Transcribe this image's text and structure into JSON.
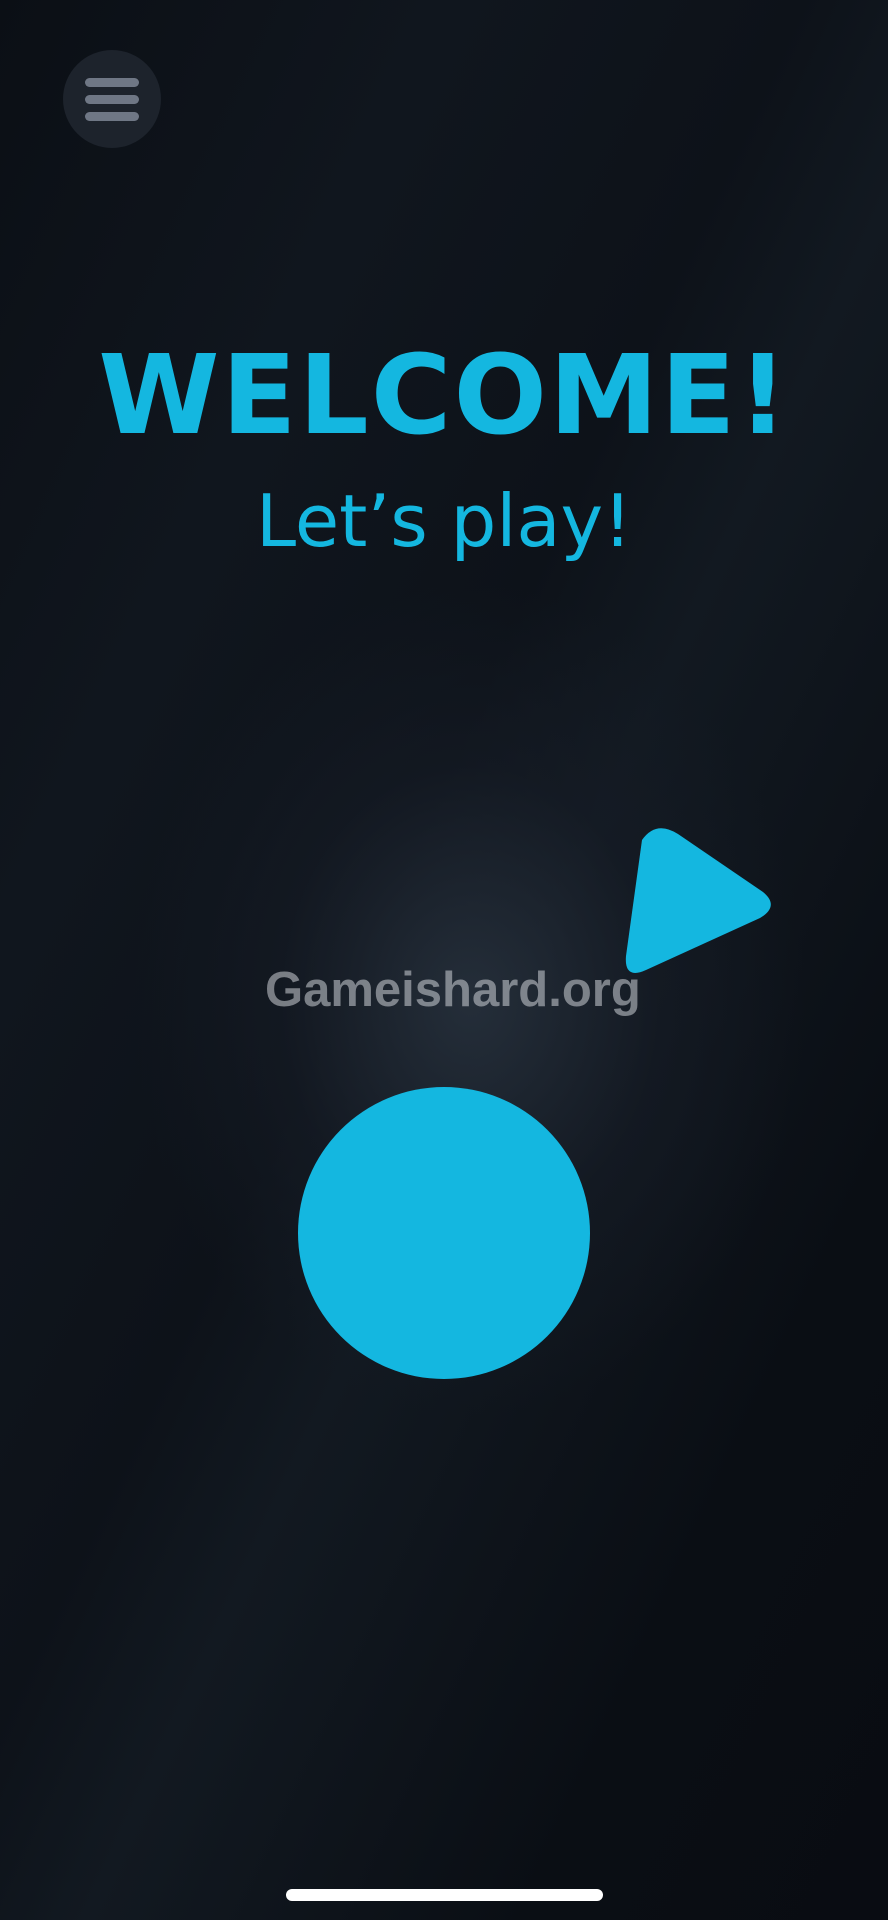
{
  "colors": {
    "accent": "#14b7e0",
    "background": "#0d1219",
    "menu_button_bg": "#1d232c",
    "menu_icon": "#6f7785",
    "watermark": "#cdd2d7",
    "home_indicator": "#ffffff"
  },
  "menu": {
    "icon": "hamburger-menu-icon"
  },
  "welcome": {
    "title": "WELCOME!",
    "subtitle": "Let’s play!"
  },
  "shapes": {
    "triangle": "play-triangle-icon",
    "circle": "circle-shape"
  },
  "watermark": {
    "text": "Gameishard.org"
  }
}
